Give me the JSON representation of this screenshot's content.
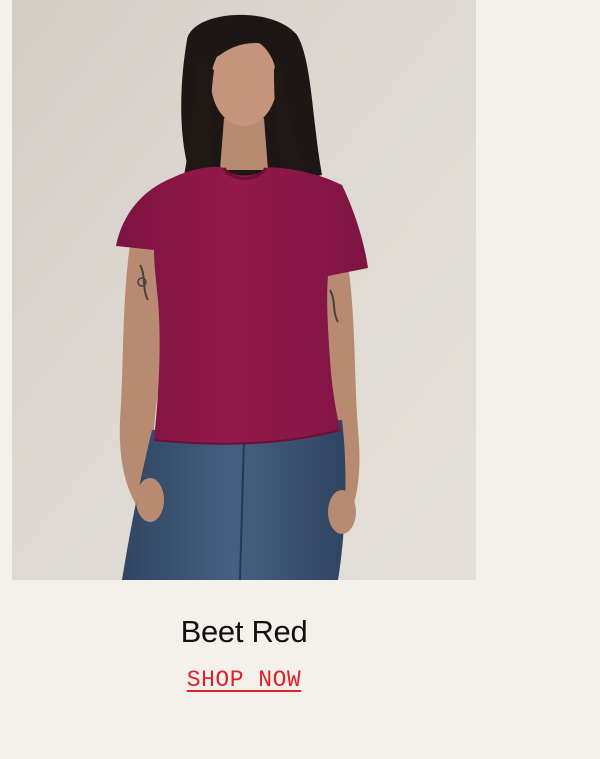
{
  "product": {
    "name": "Beet Red",
    "cta_label": "SHOP NOW",
    "image_subject": "model-wearing-beet-red-tee"
  },
  "colors": {
    "page_background": "#f4f1eb",
    "photo_background": "#dcd7cf",
    "shirt": "#8e1747",
    "denim": "#3a5270",
    "cta": "#e0202a",
    "name_text": "#111111"
  }
}
